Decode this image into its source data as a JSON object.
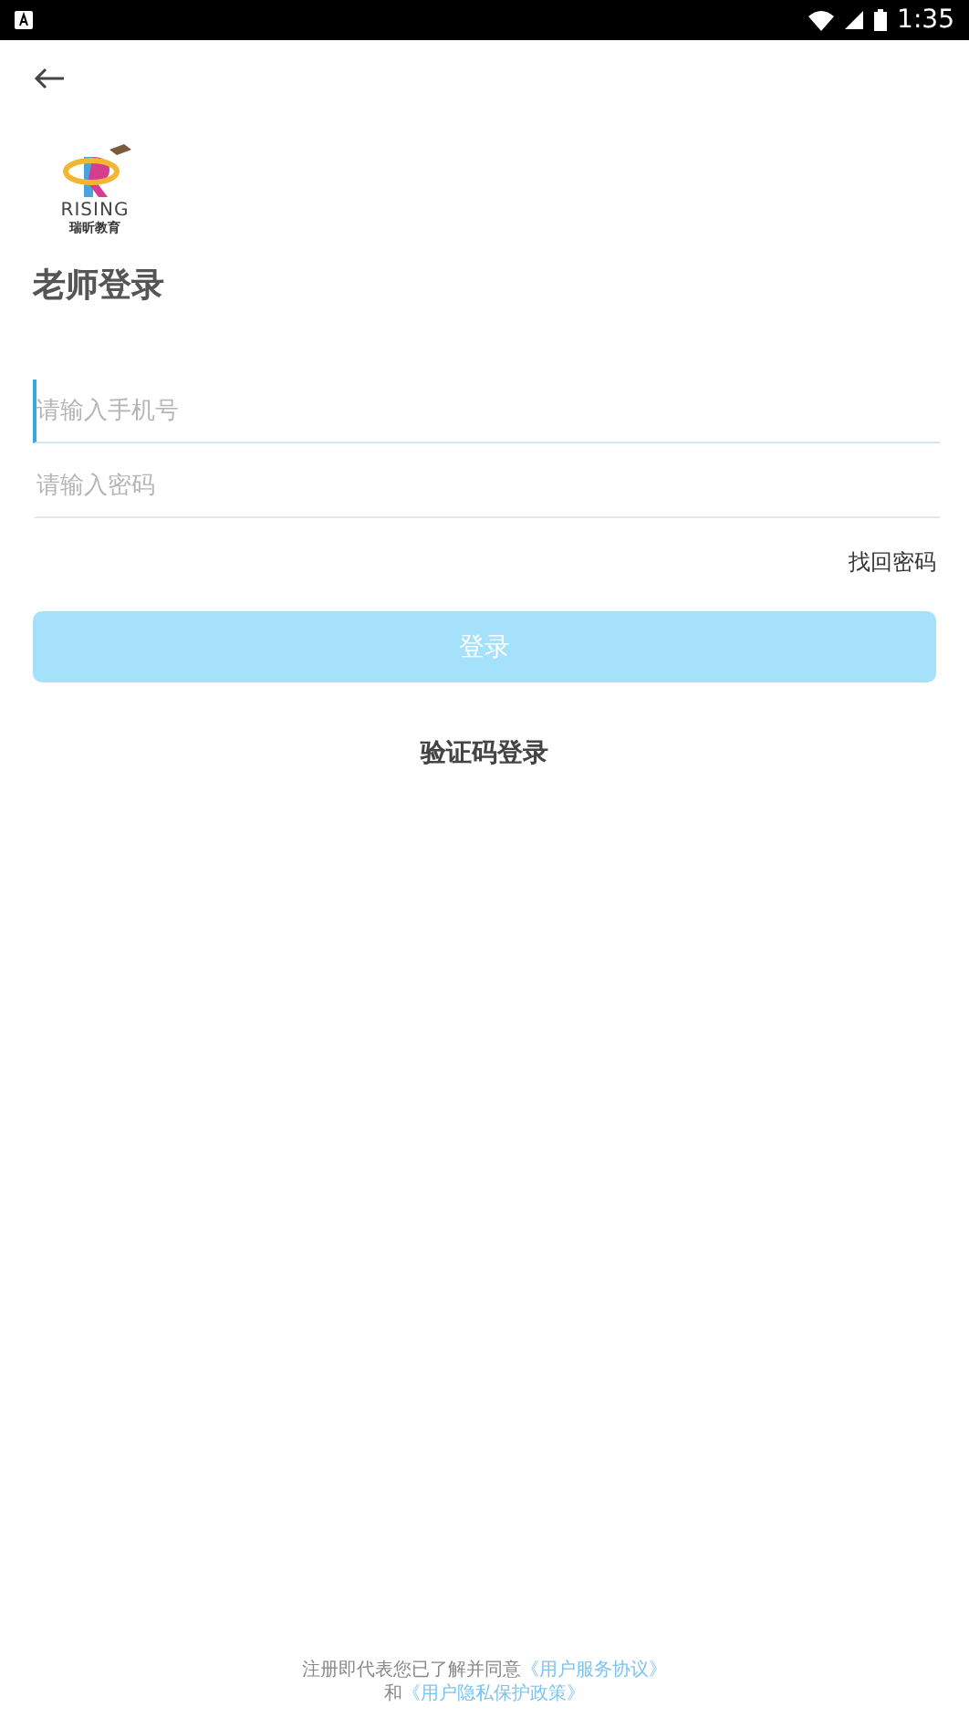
{
  "status_bar": {
    "time": "1:35"
  },
  "logo": {
    "wordmark": "RISING",
    "subtitle": "瑞昕教育"
  },
  "title": "老师登录",
  "fields": [
    {
      "placeholder": "请输入手机号",
      "focused": true
    },
    {
      "placeholder": "请输入密码",
      "focused": false
    }
  ],
  "forgot_password": "找回密码",
  "login_button": {
    "label": "登录",
    "disabled": true
  },
  "sms_login": "验证码登录",
  "agreement": {
    "text": "注册即代表您已了解并同意",
    "link1": "《用户服务协议》",
    "joiner": "和",
    "link2": "《用户隐私保护政策》"
  }
}
